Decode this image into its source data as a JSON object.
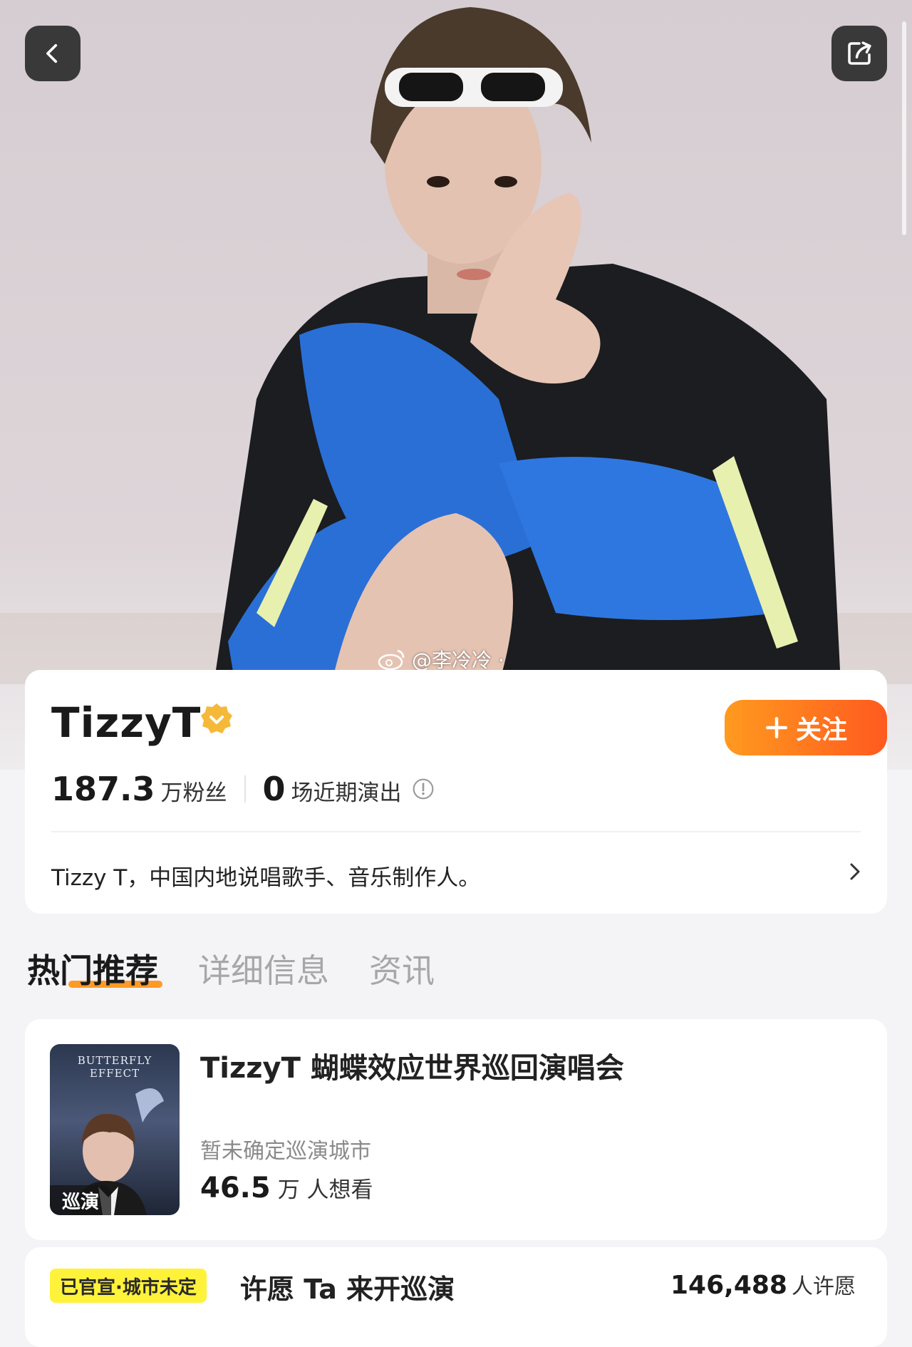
{
  "header": {
    "back_icon": "chevron-left-icon",
    "share_icon": "share-icon"
  },
  "watermark": {
    "text": "@李冷冷 ·"
  },
  "profile": {
    "name": "TizzyT",
    "verified_icon": "verified-badge-icon",
    "follow_label": "关注",
    "fans_num": "187.3",
    "fans_label": "万粉丝",
    "shows_num": "0",
    "shows_label": "场近期演出",
    "bio": "Tizzy T，中国内地说唱歌手、音乐制作人。"
  },
  "tabs": [
    {
      "label": "热门推荐",
      "active": true
    },
    {
      "label": "详细信息",
      "active": false
    },
    {
      "label": "资讯",
      "active": false
    }
  ],
  "event": {
    "poster_title": "BUTTERFLY EFFECT",
    "poster_tag": "巡演",
    "title": "TizzyT 蝴蝶效应世界巡回演唱会",
    "subtitle": "暂未确定巡演城市",
    "count_num": "46.5",
    "count_label": "万 人想看"
  },
  "wish": {
    "badge": "已官宣·城市未定",
    "text": "许愿 Ta 来开巡演",
    "count_num": "146,488",
    "count_label": "人许愿"
  },
  "colors": {
    "accent_orange": "#ff7a1f",
    "badge_yellow": "#fff23a",
    "verified_gold": "#f5b93a"
  }
}
